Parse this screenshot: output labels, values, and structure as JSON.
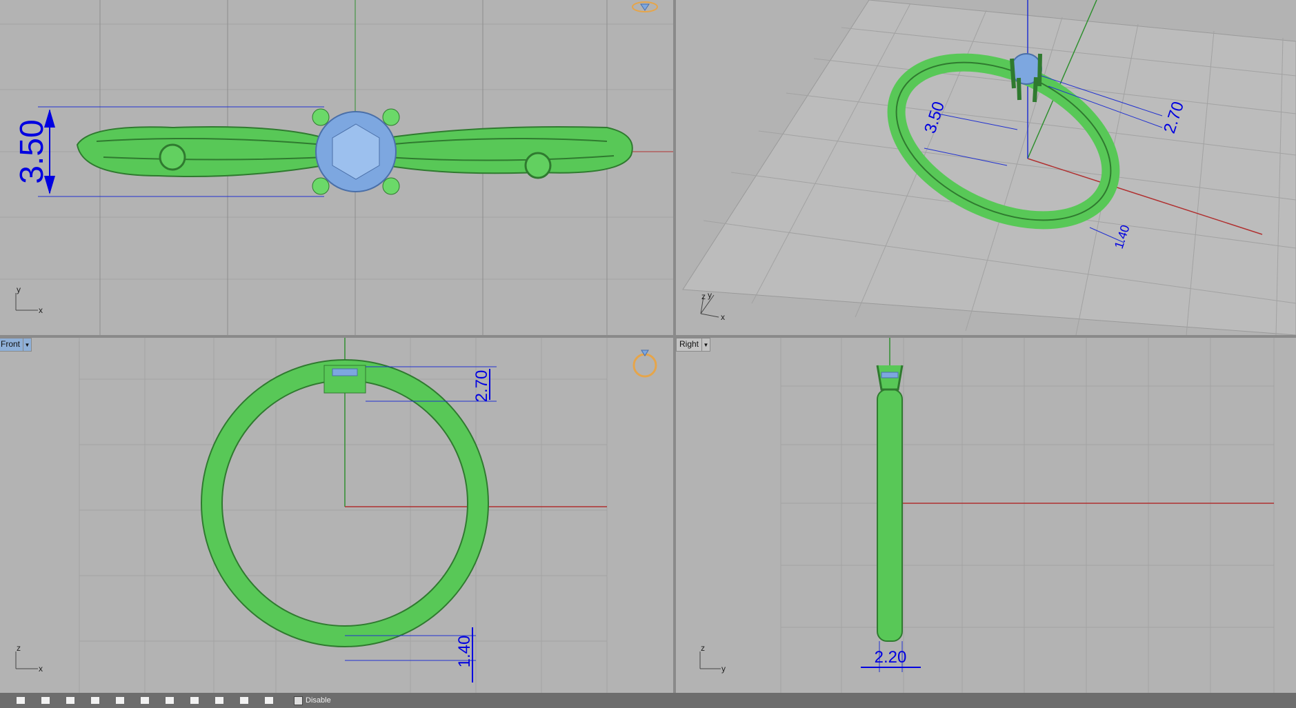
{
  "viewports": {
    "top": {
      "axis_x": "x",
      "axis_y": "y",
      "dim_width": "3.50"
    },
    "perspective": {
      "axis_x": "x",
      "axis_y": "y",
      "axis_z": "z",
      "dim_a": "3.50",
      "dim_b": "2.70",
      "dim_c": "1.40"
    },
    "front": {
      "label": "Front",
      "axis_x": "x",
      "axis_z": "z",
      "dim_top": "2.70",
      "dim_bottom": "1.40"
    },
    "right": {
      "label": "Right",
      "axis_y": "y",
      "axis_z": "z",
      "dim_bottom": "2.20"
    }
  },
  "statusbar": {
    "disable_label": "Disable",
    "snap_count": 11
  },
  "colors": {
    "viewport_bg": "#b3b3b3",
    "grid": "#a0a0a0",
    "grid_major": "#7d7d7d",
    "ring": "#5cd35a",
    "gem": "#7da7e0",
    "dimension": "#0000e0",
    "axis_x": "#b03030",
    "axis_y": "#2f8f2f"
  }
}
